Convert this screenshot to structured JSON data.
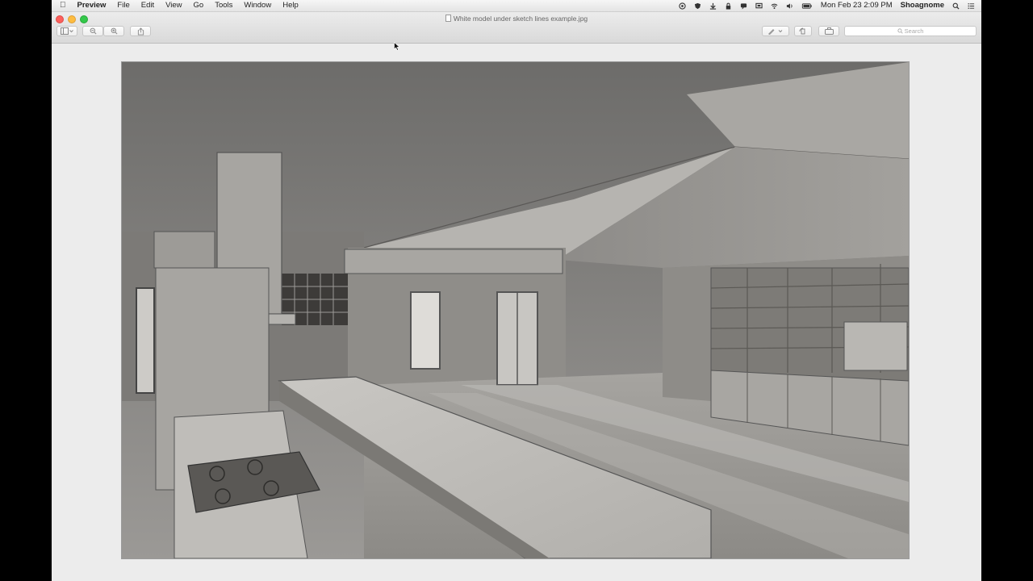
{
  "menubar": {
    "app_name": "Preview",
    "menus": [
      "File",
      "Edit",
      "View",
      "Go",
      "Tools",
      "Window",
      "Help"
    ],
    "clock": "Mon Feb 23  2:09 PM",
    "user": "Shoagnome"
  },
  "window": {
    "title": "White model under sketch lines example.jpg",
    "search_placeholder": "Search"
  },
  "icons": {
    "apple": "apple-icon",
    "sidebar_toggle": "sidebar-icon",
    "zoom_out": "zoom-out-icon",
    "zoom_in": "zoom-in-icon",
    "share": "share-icon",
    "markup": "pen-icon",
    "rotate": "rotate-icon",
    "toolbox": "toolbox-icon",
    "search": "search-icon"
  },
  "colors": {
    "close": "#fc605c",
    "minimize": "#fdbc40",
    "maximize": "#34c84a"
  }
}
